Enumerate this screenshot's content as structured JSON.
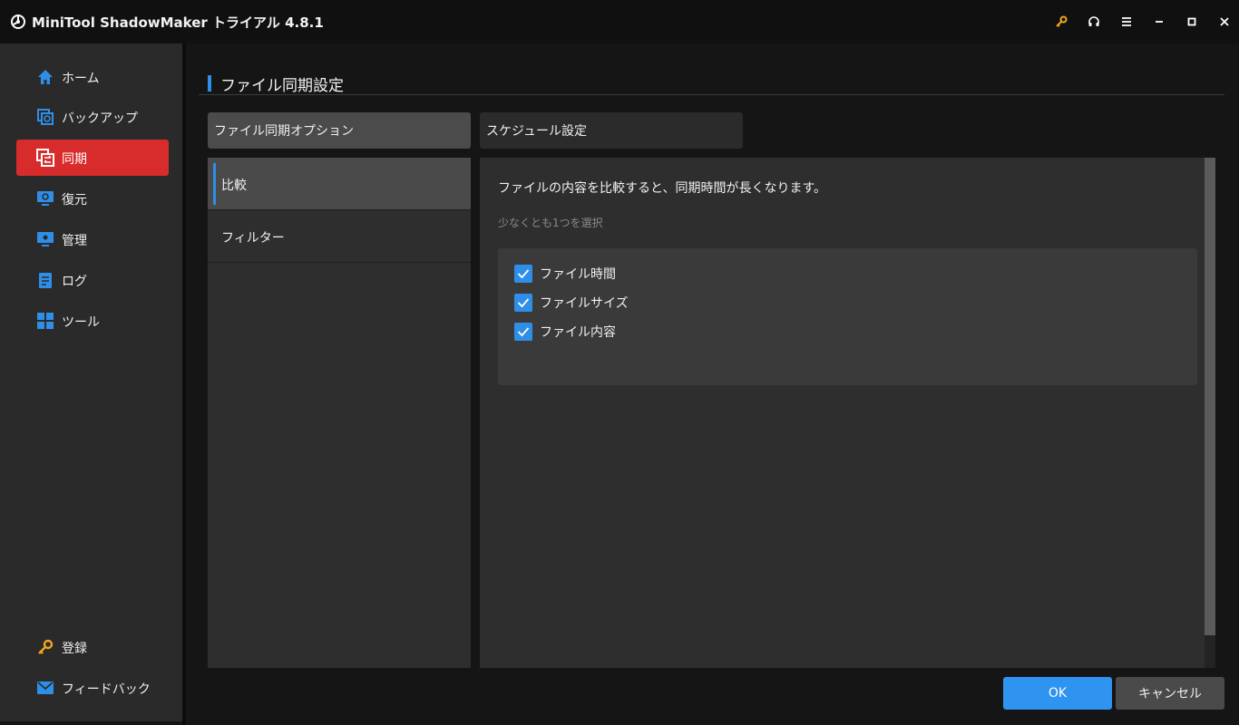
{
  "titlebar": {
    "title": "MiniTool ShadowMaker トライアル 4.8.1",
    "icons": [
      "logo-icon",
      "key-icon",
      "headset-icon",
      "menu-icon",
      "minimize-icon",
      "maximize-icon",
      "close-icon"
    ]
  },
  "sidebar": {
    "items": [
      {
        "label": "ホーム",
        "icon": "home-icon"
      },
      {
        "label": "バックアップ",
        "icon": "backup-icon"
      },
      {
        "label": "同期",
        "icon": "sync-icon",
        "active": true
      },
      {
        "label": "復元",
        "icon": "restore-icon"
      },
      {
        "label": "管理",
        "icon": "manage-icon"
      },
      {
        "label": "ログ",
        "icon": "log-icon"
      },
      {
        "label": "ツール",
        "icon": "tools-icon"
      }
    ],
    "footer": [
      {
        "label": "登録",
        "icon": "key-icon"
      },
      {
        "label": "フィードバック",
        "icon": "mail-icon"
      }
    ]
  },
  "main": {
    "page_title": "ファイル同期設定",
    "tabs": [
      {
        "label": "ファイル同期オプション",
        "active": true
      },
      {
        "label": "スケジュール設定",
        "active": false
      }
    ],
    "subnav": [
      {
        "label": "比較",
        "active": true
      },
      {
        "label": "フィルター",
        "active": false
      }
    ],
    "compare": {
      "description": "ファイルの内容を比較すると、同期時間が長くなります。",
      "hint": "少なくとも1つを選択",
      "options": [
        {
          "label": "ファイル時間",
          "checked": true
        },
        {
          "label": "ファイルサイズ",
          "checked": true
        },
        {
          "label": "ファイル内容",
          "checked": true
        }
      ]
    },
    "buttons": {
      "ok": "OK",
      "cancel": "キャンセル"
    }
  },
  "colors": {
    "accent": "#2f8fe8",
    "active_nav": "#d82b2b",
    "key_icon": "#f0a81c"
  }
}
